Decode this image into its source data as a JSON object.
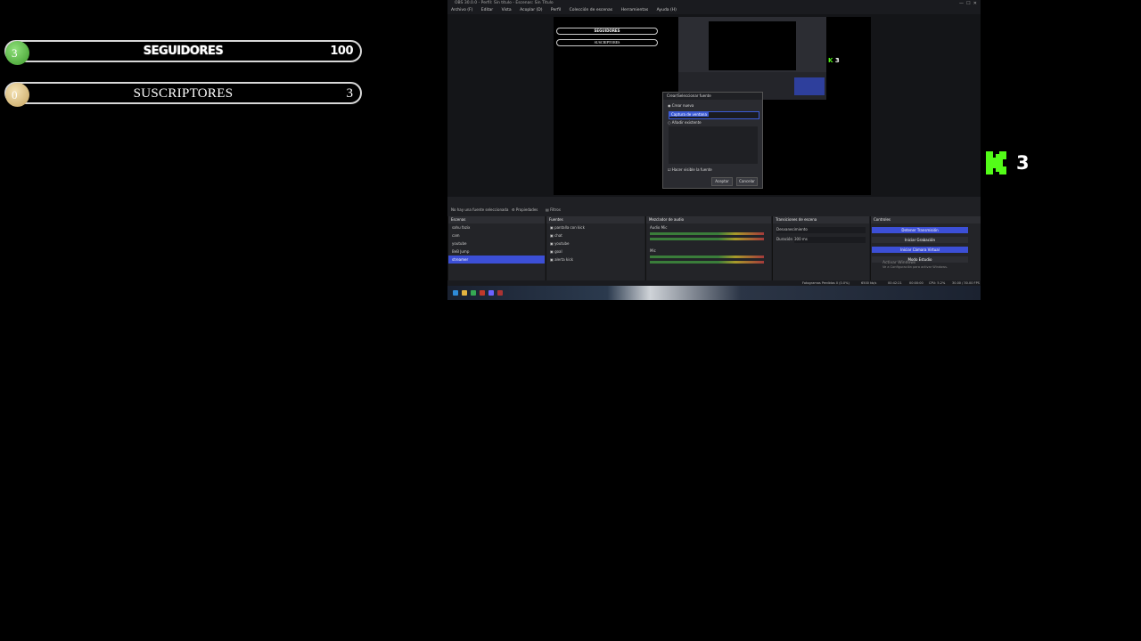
{
  "goals": [
    {
      "knob": "3",
      "title": "SEGUIDORES",
      "value": "100"
    },
    {
      "knob": "0",
      "title": "SUSCRIPTORES",
      "value": "3"
    }
  ],
  "kick": {
    "count": "3",
    "logo": "kick-k-logo",
    "color": "#53fc18"
  },
  "obs": {
    "window_title": "OBS 30.0.0 - Perfil: Sin título - Escenas: Sin Título",
    "menu": [
      "Archivo (F)",
      "Editar",
      "Vista",
      "Acoplar (D)",
      "Perfil",
      "Colección de escenas",
      "Herramientas",
      "Ayuda (H)"
    ],
    "dialog": {
      "title": "Crear/Seleccionar fuente",
      "option_new": "Crear nueva",
      "input_value": "Captura de ventana",
      "option_existing": "Añadir existente",
      "checkbox": "Hacer visible la fuente",
      "accept": "Aceptar",
      "cancel": "Cancelar"
    },
    "toolbar": {
      "no_source": "No hay una fuente seleccionada",
      "properties": "Propiedades",
      "filters": "Filtros"
    },
    "scenes": {
      "title": "Escenas",
      "items": [
        "sahu fazix",
        "cam",
        "youtube",
        "BeB Jump",
        "streamer"
      ],
      "selected": 4
    },
    "sources": {
      "title": "Fuentes",
      "items": [
        "pantalla con kick",
        "chat",
        "youtube",
        "goal",
        "alerta kick"
      ]
    },
    "mixer": {
      "title": "Mezclador de audio",
      "tracks": [
        "Audio Mic",
        "Mic"
      ]
    },
    "transitions": {
      "title": "Transiciones de escena",
      "type": "Desvanecimiento",
      "duration_label": "Duración",
      "duration": "300 ms"
    },
    "controls": {
      "title": "Controles",
      "buttons": [
        "Detener Transmisión",
        "Iniciar Grabación",
        "Iniciar Cámara Virtual",
        "Modo Estudio"
      ]
    },
    "activate": {
      "line1": "Activar Windows",
      "line2": "Ve a Configuración para activar Windows."
    },
    "status": {
      "dropped": "Fotogramas Perdidos 0 (0.0%)",
      "bitrate": "6500 kb/s",
      "time_live": "00:42:21",
      "time_rec": "00:00:00",
      "cpu": "CPU: 5.2%",
      "fps": "30.00 / 30.00 FPS"
    }
  }
}
